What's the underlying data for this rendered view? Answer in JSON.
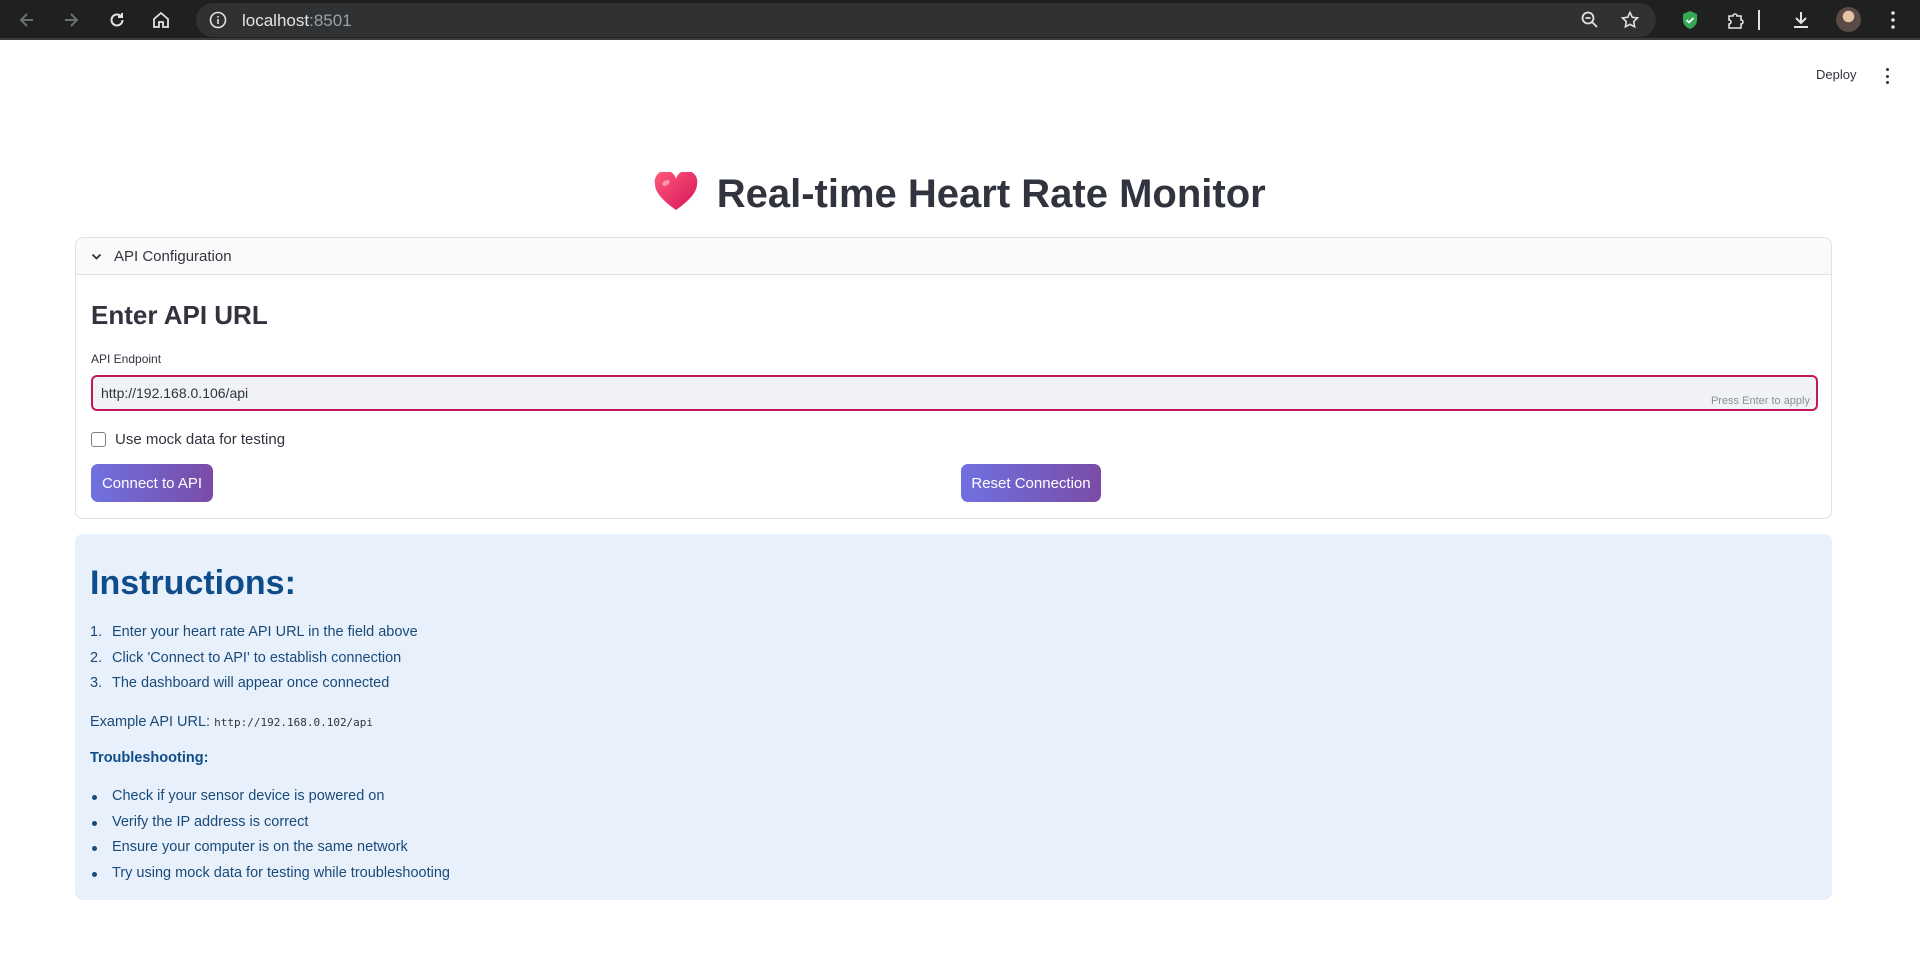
{
  "browser": {
    "url_host": "localhost",
    "url_port": ":8501"
  },
  "header": {
    "deploy_label": "Deploy"
  },
  "page": {
    "title": "Real-time Heart Rate Monitor",
    "heart_icon": "heart-icon"
  },
  "api_config": {
    "expander_label": "API Configuration",
    "heading": "Enter API URL",
    "field_label": "API Endpoint",
    "field_value": "http://192.168.0.106/api",
    "field_hint": "Press Enter to apply",
    "mock_checkbox_label": "Use mock data for testing",
    "mock_checked": false,
    "connect_button": "Connect to API",
    "reset_button": "Reset Connection"
  },
  "instructions": {
    "heading": "Instructions:",
    "steps": [
      {
        "num": "1.",
        "text": "Enter your heart rate API URL in the field above"
      },
      {
        "num": "2.",
        "text": "Click 'Connect to API' to establish connection"
      },
      {
        "num": "3.",
        "text": "The dashboard will appear once connected"
      }
    ],
    "example_label": "Example API URL:",
    "example_url": "http://192.168.0.102/api",
    "troubleshooting_heading": "Troubleshooting:",
    "tips": [
      "Check if your sensor device is powered on",
      "Verify the IP address is correct",
      "Ensure your computer is on the same network",
      "Try using mock data for testing while troubleshooting"
    ]
  },
  "colors": {
    "accent_gradient_start": "#6f71e0",
    "accent_gradient_end": "#7a4ca6",
    "info_bg": "#e8f1fb",
    "info_text": "#1a4a7a",
    "input_focus_border": "#c2185b"
  }
}
